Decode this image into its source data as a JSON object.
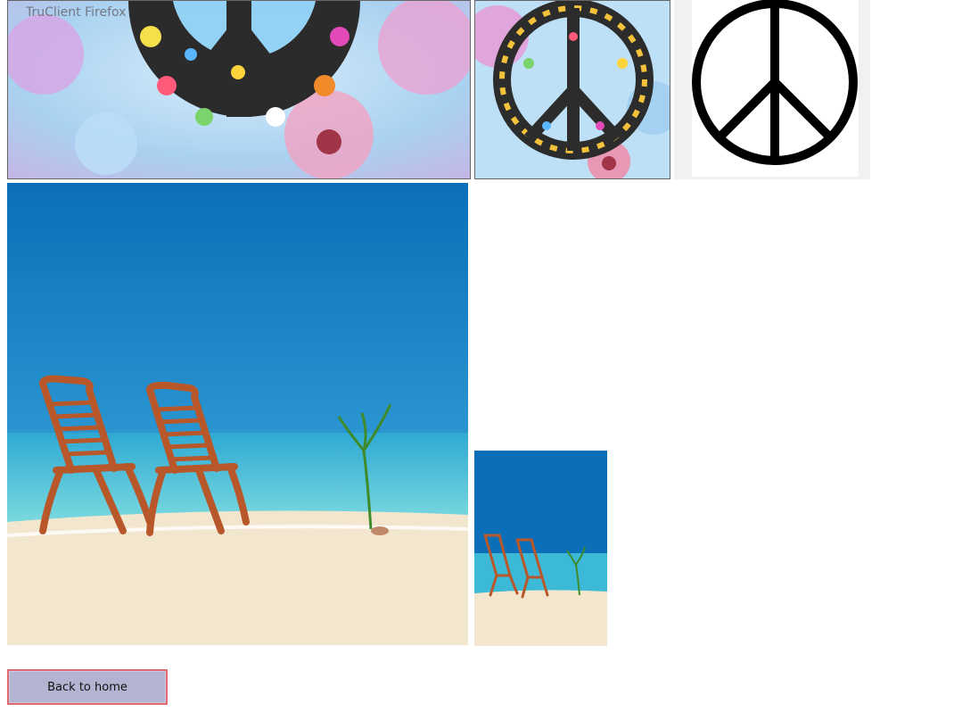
{
  "watermark": "TruClient Firefox",
  "images": {
    "peace_large": "peace-sign-flowers-large-image",
    "peace_medium": "peace-sign-flowers-thumbnail-image",
    "peace_symbol": "peace-symbol-black-image",
    "beach_large": "beach-chairs-large-image",
    "beach_small": "beach-chairs-thumbnail-image"
  },
  "actions": {
    "back_label": "Back to home"
  },
  "colors": {
    "button_bg": "#b4b4d2",
    "button_border": "#e06a70",
    "sea_top": "#0a6fb8",
    "sea_water": "#38bcd6",
    "sand": "#f3e6cf",
    "chair": "#b8582a"
  }
}
